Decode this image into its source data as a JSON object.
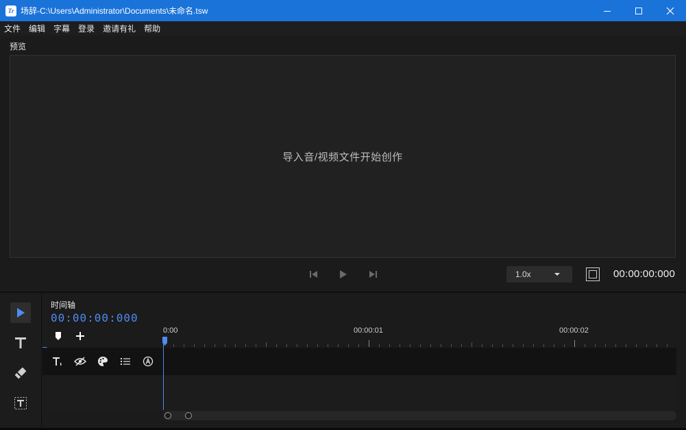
{
  "window": {
    "app_icon_text": "Tr",
    "title": "场辞-C:\\Users\\Administrator\\Documents\\未命名.tsw",
    "controls": [
      "minimize-icon",
      "maximize-icon",
      "close-icon"
    ]
  },
  "menu": {
    "items": [
      {
        "label": "文件"
      },
      {
        "label": "编辑"
      },
      {
        "label": "字幕"
      },
      {
        "label": "登录"
      },
      {
        "label": "邀请有礼"
      },
      {
        "label": "帮助"
      }
    ]
  },
  "preview": {
    "label": "预览",
    "hint": "导入音/视频文件开始创作",
    "speed": "1.0x",
    "timecode": "00:00:00:000"
  },
  "timeline": {
    "title": "时间轴",
    "timecode": "00:00:00:000",
    "ruler_labels": [
      "0:00",
      "00:00:01",
      "00:00:02"
    ]
  },
  "tools": [
    "pointer-tool-icon",
    "text-tool-icon",
    "eraser-tool-icon",
    "text-box-tool-icon"
  ],
  "colors": {
    "titlebar": "#1a73d9",
    "accent": "#4e8cf0",
    "background": "#1b1b1b"
  }
}
